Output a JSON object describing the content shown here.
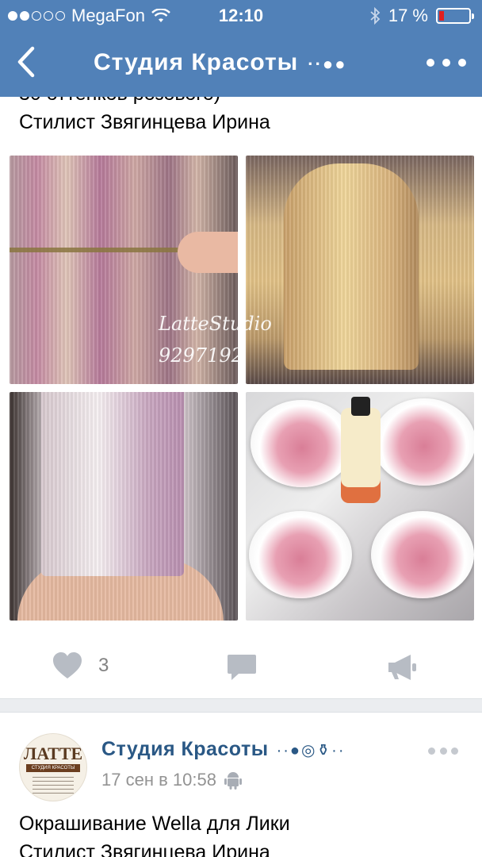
{
  "status_bar": {
    "carrier": "MegaFon",
    "time": "12:10",
    "battery_percent": "17 %",
    "battery_level": 0.17,
    "signal_bars_filled": 2,
    "signal_bars_total": 5
  },
  "nav": {
    "title": "Студия  Красоты",
    "title_emoji": "··●●"
  },
  "post1": {
    "text_line1": "30 оттенков розового)",
    "text_line2": "Стилист  Звягинцева  Ирина",
    "watermark": "LatteStudio\n9297192",
    "likes_count": "3"
  },
  "post2": {
    "author": "Студия  Красоты",
    "author_emoji": "··●◎⚱··",
    "avatar_logo": "ЛАТТЕ",
    "avatar_subtitle": "СТУДИЯ КРАСОТЫ",
    "timestamp": "17 сен в 10:58",
    "text_line1": "Окрашивание  Wella для Лики",
    "text_line2": "Стилист  Звягинцева  Ирина"
  },
  "colors": {
    "header_bg": "#5181b8",
    "link": "#2a5885",
    "muted": "#828282",
    "battery_low": "#e02020"
  }
}
